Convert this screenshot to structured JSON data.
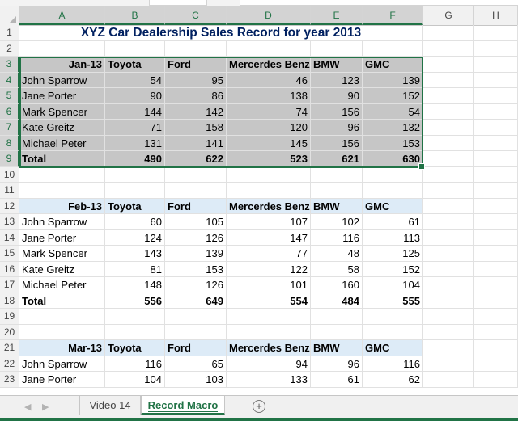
{
  "columns": [
    "A",
    "B",
    "C",
    "D",
    "E",
    "F",
    "G",
    "H"
  ],
  "title": "XYZ Car Dealership Sales Record for year 2013",
  "blocks": [
    {
      "month": "Jan-13",
      "headers": [
        "Toyota",
        "Ford",
        "Mercerdes Benz",
        "BMW",
        "GMC"
      ],
      "rows": [
        {
          "name": "John Sparrow",
          "values": [
            54,
            95,
            46,
            123,
            139
          ]
        },
        {
          "name": "Jane Porter",
          "values": [
            90,
            86,
            138,
            90,
            152
          ]
        },
        {
          "name": "Mark Spencer",
          "values": [
            144,
            142,
            74,
            156,
            54
          ]
        },
        {
          "name": "Kate Greitz",
          "values": [
            71,
            158,
            120,
            96,
            132
          ]
        },
        {
          "name": "Michael Peter",
          "values": [
            131,
            141,
            145,
            156,
            153
          ]
        }
      ],
      "total_label": "Total",
      "totals": [
        490,
        622,
        523,
        621,
        630
      ]
    },
    {
      "month": "Feb-13",
      "headers": [
        "Toyota",
        "Ford",
        "Mercerdes Benz",
        "BMW",
        "GMC"
      ],
      "rows": [
        {
          "name": "John Sparrow",
          "values": [
            60,
            105,
            107,
            102,
            61
          ]
        },
        {
          "name": "Jane Porter",
          "values": [
            124,
            126,
            147,
            116,
            113
          ]
        },
        {
          "name": "Mark Spencer",
          "values": [
            143,
            139,
            77,
            48,
            125
          ]
        },
        {
          "name": "Kate Greitz",
          "values": [
            81,
            153,
            122,
            58,
            152
          ]
        },
        {
          "name": "Michael Peter",
          "values": [
            148,
            126,
            101,
            160,
            104
          ]
        }
      ],
      "total_label": "Total",
      "totals": [
        556,
        649,
        554,
        484,
        555
      ]
    },
    {
      "month": "Mar-13",
      "headers": [
        "Toyota",
        "Ford",
        "Mercerdes Benz",
        "BMW",
        "GMC"
      ],
      "rows": [
        {
          "name": "John Sparrow",
          "values": [
            116,
            65,
            94,
            96,
            116
          ]
        },
        {
          "name": "Jane Porter",
          "values": [
            104,
            103,
            133,
            61,
            62
          ]
        }
      ]
    }
  ],
  "sheet_tabs": [
    {
      "label": "Video 14",
      "active": false
    },
    {
      "label": "Record Macro",
      "active": true
    }
  ],
  "add_sheet_symbol": "+",
  "nav_icons": [
    "left-arrow-icon",
    "right-arrow-icon"
  ],
  "colors": {
    "accent": "#217346",
    "title": "#002060",
    "selection_fill": "#c6c6c6",
    "header_fill": "#ddebf7"
  }
}
